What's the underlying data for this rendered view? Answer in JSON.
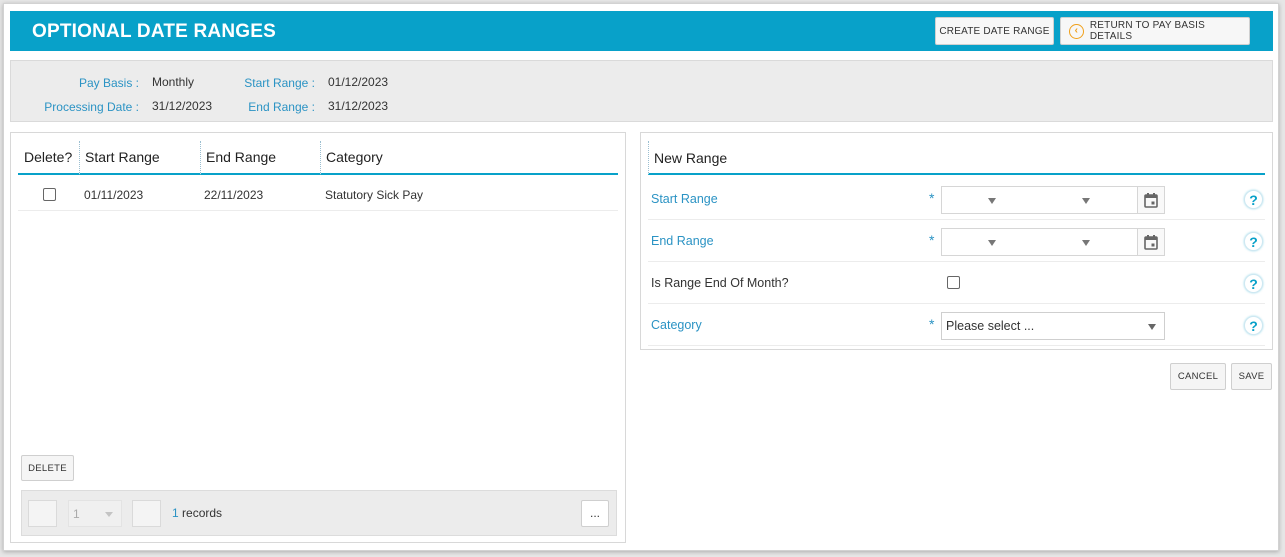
{
  "header": {
    "title": "OPTIONAL DATE RANGES",
    "create_label": "CREATE DATE RANGE",
    "return_label": "RETURN TO PAY BASIS DETAILS"
  },
  "summary": {
    "pay_basis_label": "Pay Basis :",
    "pay_basis_value": "Monthly",
    "start_range_label": "Start Range :",
    "start_range_value": "01/12/2023",
    "processing_date_label": "Processing Date :",
    "processing_date_value": "31/12/2023",
    "end_range_label": "End Range :",
    "end_range_value": "31/12/2023"
  },
  "table": {
    "columns": [
      "Delete?",
      "Start Range",
      "End Range",
      "Category"
    ],
    "rows": [
      {
        "delete": false,
        "start": "01/11/2023",
        "end": "22/11/2023",
        "category": "Statutory Sick Pay"
      }
    ],
    "delete_button": "DELETE",
    "pager": {
      "page_value": "1",
      "records_count": "1",
      "records_label": "records",
      "more_label": "..."
    }
  },
  "new_range": {
    "heading": "New Range",
    "fields": [
      {
        "label": "Start Range",
        "required": "*"
      },
      {
        "label": "End Range",
        "required": "*"
      },
      {
        "label": "Is Range End Of Month?"
      },
      {
        "label": "Category",
        "required": "*",
        "placeholder": "Please select ..."
      }
    ],
    "help_glyph": "?",
    "cancel_label": "CANCEL",
    "save_label": "SAVE"
  },
  "colors": {
    "accent": "#08a1c9",
    "label_blue": "#2b93c4",
    "return_icon": "#f0a01b"
  },
  "icons": [
    "circle-chevron-left-icon",
    "calendar-icon",
    "chevron-down-icon",
    "help-icon"
  ]
}
